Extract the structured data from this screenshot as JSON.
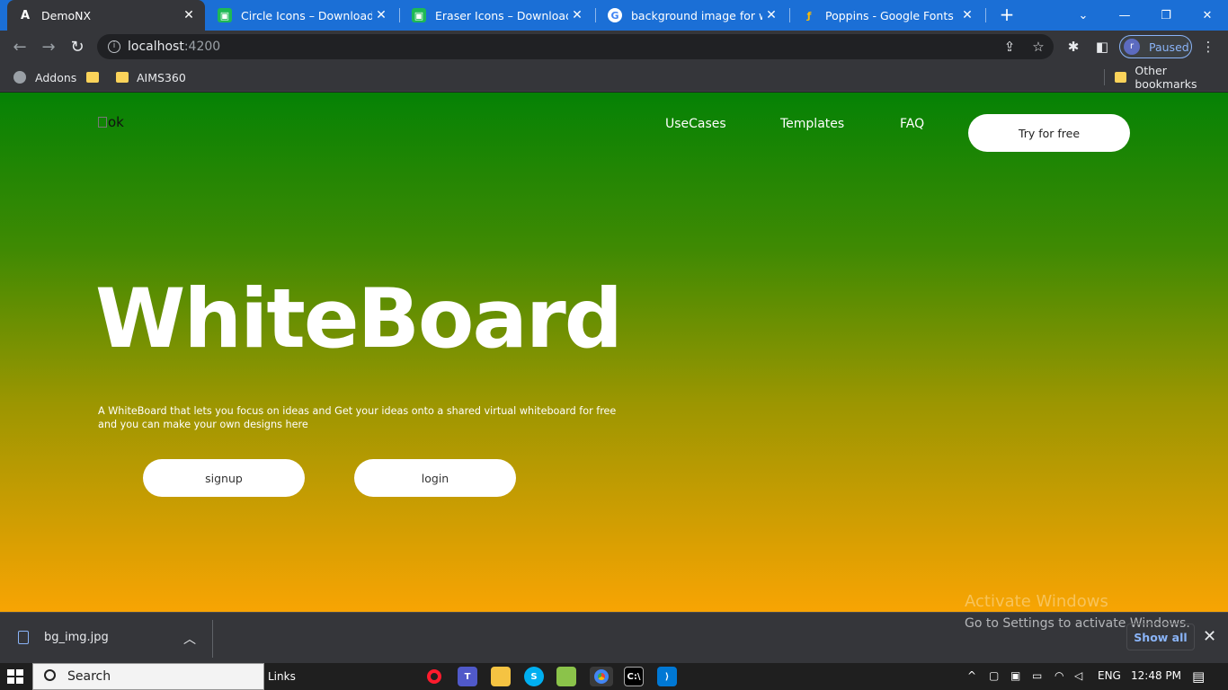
{
  "browser": {
    "tabs": [
      {
        "title": "DemoNX",
        "favicon": "angular-icon",
        "active": true
      },
      {
        "title": "Circle Icons – Download for F",
        "favicon": "flaticon-icon"
      },
      {
        "title": "Eraser Icons – Download for F",
        "favicon": "flaticon-icon"
      },
      {
        "title": "background image for websi",
        "favicon": "google-icon"
      },
      {
        "title": "Poppins - Google Fonts",
        "favicon": "google-fonts-icon"
      }
    ],
    "address": {
      "host": "localhost",
      "port": ":4200"
    },
    "profile_status": "Paused",
    "profile_initial": "r",
    "bookmarks": [
      {
        "label": "Addons",
        "icon": "globe-icon"
      },
      {
        "label": "",
        "icon": "folder-icon"
      },
      {
        "label": "AIMS360",
        "icon": "folder-icon"
      }
    ],
    "other_bookmarks": "Other bookmarks"
  },
  "page": {
    "logo_alt": "ok",
    "nav": [
      "UseCases",
      "Templates",
      "FAQ"
    ],
    "try_button": "Try for free",
    "hero_title": "WhiteBoard",
    "hero_desc_line1": "A WhiteBoard that lets you focus on ideas and Get your ideas onto a shared virtual whiteboard for free",
    "hero_desc_line2": "and you can make your own designs here",
    "signup": "signup",
    "login": "login",
    "gradient": {
      "top": "#058205",
      "bottom": "#f8a403"
    }
  },
  "downloads": {
    "file": "bg_img.jpg",
    "show_all": "Show all",
    "activate_title": "Activate Windows",
    "activate_sub": "Go to Settings to activate Windows."
  },
  "taskbar": {
    "search": "Search",
    "links": "Links",
    "lang": "ENG",
    "time": "12:48 PM"
  }
}
